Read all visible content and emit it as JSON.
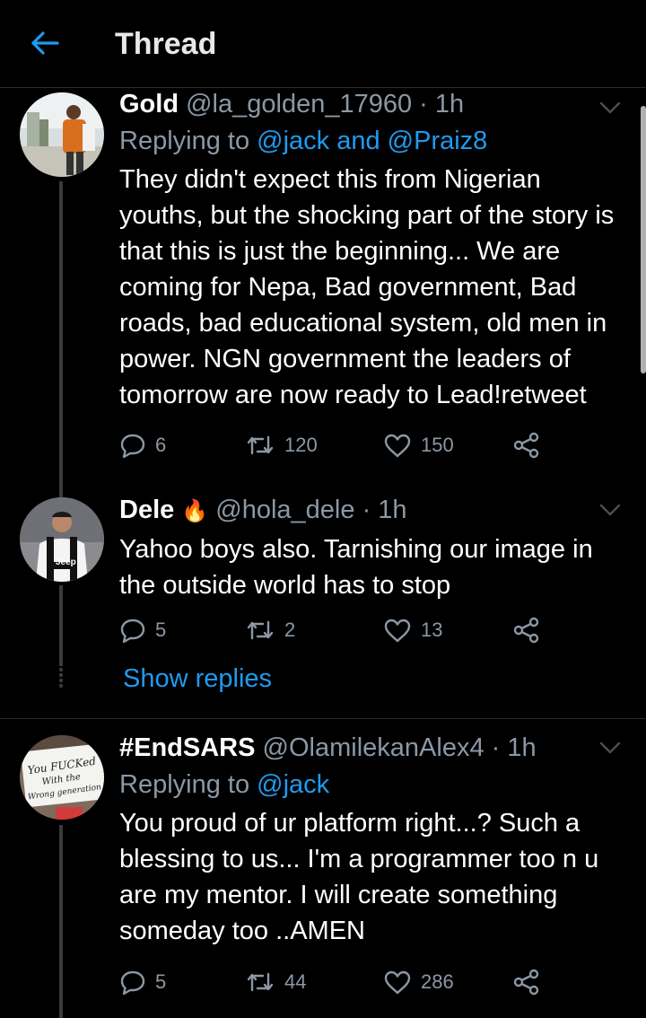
{
  "header": {
    "title": "Thread"
  },
  "tweets": [
    {
      "name": "Gold",
      "handle": "@la_golden_17960",
      "time": "· 1h",
      "replying_prefix": "Replying to",
      "replying_to": "@jack and @Praiz8",
      "text": "They didn't expect this from Nigerian youths, but the shocking part of the story is that this is just the beginning... We are coming for Nepa, Bad government, Bad roads, bad educational system, old men in power. NGN government the leaders of tomorrow are now ready to Lead!retweet",
      "replies": "6",
      "retweets": "120",
      "likes": "150"
    },
    {
      "name": "Dele",
      "emoji": "🔥",
      "handle": "@hola_dele",
      "time": "· 1h",
      "text": "Yahoo boys also. Tarnishing our image in the outside world has to stop",
      "replies": "5",
      "retweets": "2",
      "likes": "13"
    },
    {
      "name": "#EndSARS",
      "handle": "@OlamilekanAlex4",
      "time": "· 1h",
      "replying_prefix": "Replying to",
      "replying_to": "@jack",
      "text": "You proud of ur platform right...? Such a blessing to us... I'm a programmer too n u are my mentor. I will create something someday too ..AMEN",
      "replies": "5",
      "retweets": "44",
      "likes": "286"
    }
  ],
  "show_replies": "Show replies",
  "avatar3_sign": [
    "You FUCKed",
    "With the",
    "Wrong generation"
  ],
  "colors": {
    "accent": "#1d9bf0",
    "secondary": "#8b98a5",
    "background": "#000000"
  }
}
